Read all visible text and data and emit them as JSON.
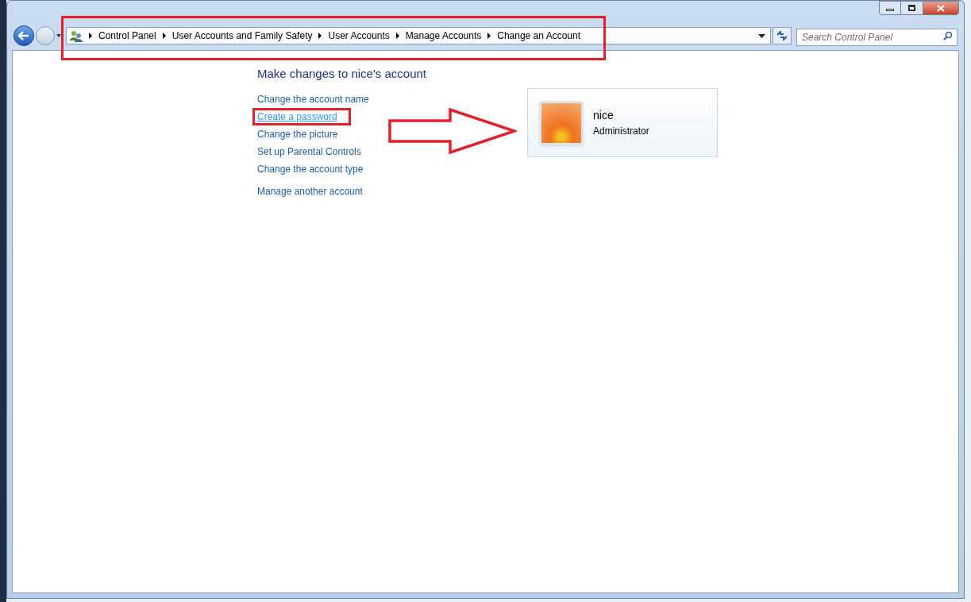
{
  "breadcrumb": [
    "Control Panel",
    "User Accounts and Family Safety",
    "User Accounts",
    "Manage Accounts",
    "Change an Account"
  ],
  "search": {
    "placeholder": "Search Control Panel"
  },
  "heading": "Make changes to nice's account",
  "tasks": [
    {
      "label": "Change the account name",
      "hovered": false
    },
    {
      "label": "Create a password",
      "hovered": true
    },
    {
      "label": "Change the picture",
      "hovered": false
    },
    {
      "label": "Set up Parental Controls",
      "hovered": false
    },
    {
      "label": "Change the account type",
      "hovered": false
    }
  ],
  "other_task": "Manage another account",
  "account": {
    "name": "nice",
    "type": "Administrator"
  }
}
